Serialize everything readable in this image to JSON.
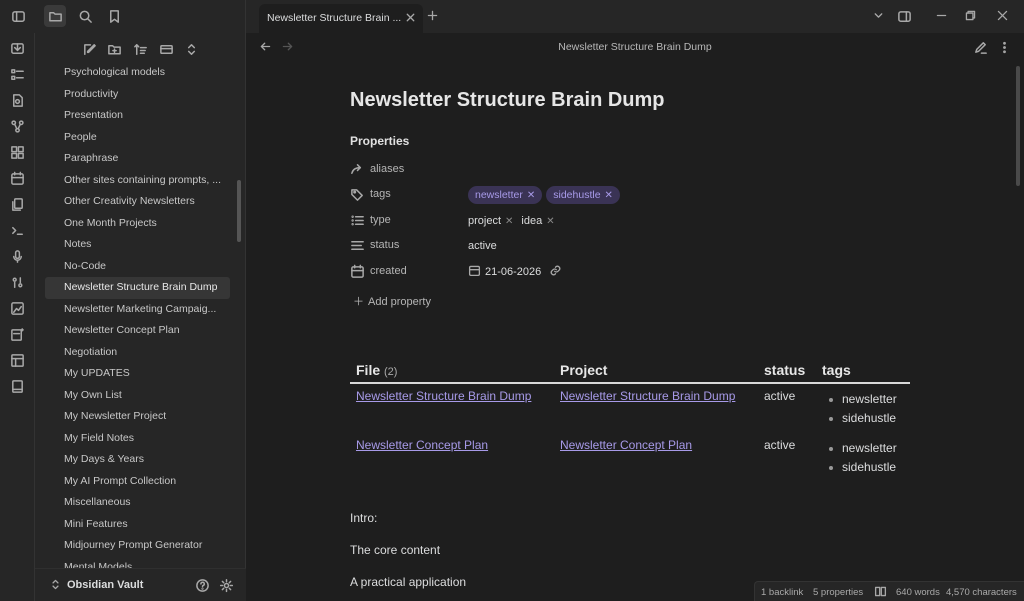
{
  "app": {
    "vault_name": "Obsidian Vault"
  },
  "explorer": {
    "files": [
      "Psychological models",
      "Productivity",
      "Presentation",
      "People",
      "Paraphrase",
      "Other sites containing prompts, ...",
      "Other Creativity Newsletters",
      "One Month Projects",
      "Notes",
      "No-Code",
      "Newsletter Structure Brain Dump",
      "Newsletter Marketing Campaig...",
      "Newsletter Concept Plan",
      "Negotiation",
      "My UPDATES",
      "My Own List",
      "My Newsletter  Project",
      "My Field Notes",
      "My Days & Years",
      "My AI Prompt Collection",
      "Miscellaneous",
      "Mini Features",
      "Midjourney Prompt Generator",
      "Mental Models"
    ],
    "active_index": 10
  },
  "tab": {
    "title": "Newsletter Structure Brain ..."
  },
  "view": {
    "title": "Newsletter Structure Brain Dump"
  },
  "note": {
    "title": "Newsletter Structure Brain Dump",
    "properties_heading": "Properties",
    "properties": {
      "aliases": {
        "key": "aliases"
      },
      "tags": {
        "key": "tags",
        "values": [
          "newsletter",
          "sidehustle"
        ]
      },
      "type": {
        "key": "type",
        "values": [
          "project",
          "idea"
        ]
      },
      "status": {
        "key": "status",
        "value": "active"
      },
      "created": {
        "key": "created",
        "value": "21-06-2026"
      }
    },
    "add_property": "Add property",
    "table": {
      "headers": {
        "file": "File",
        "file_count": "(2)",
        "project": "Project",
        "status": "status",
        "tags": "tags"
      },
      "rows": [
        {
          "file": "Newsletter Structure Brain Dump",
          "project": "Newsletter Structure Brain Dump",
          "status": "active",
          "tags": [
            "newsletter",
            "sidehustle"
          ]
        },
        {
          "file": "Newsletter Concept Plan",
          "project": "Newsletter Concept Plan",
          "status": "active",
          "tags": [
            "newsletter",
            "sidehustle"
          ]
        }
      ]
    },
    "paragraphs": [
      "Intro:",
      "The core content",
      "A practical application"
    ]
  },
  "statusbar": {
    "backlinks": "1 backlink",
    "properties": "5 properties",
    "words": "640 words",
    "characters": "4,570 characters"
  },
  "colors": {
    "background": "#1e1e1e",
    "sidebar": "#262626",
    "accent": "#a79ae8",
    "tag_bg": "#3a3355"
  }
}
